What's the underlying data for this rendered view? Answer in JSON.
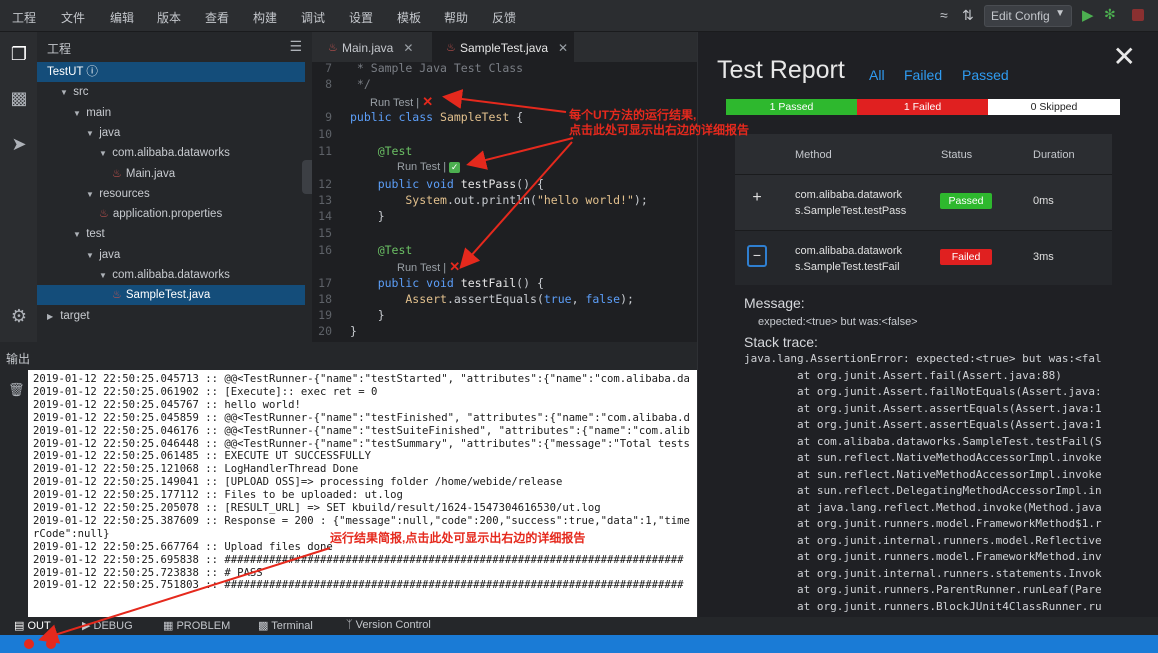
{
  "menubar": {
    "items": [
      "工程",
      "文件",
      "编辑",
      "版本",
      "查看",
      "构建",
      "调试",
      "设置",
      "模板",
      "帮助",
      "反馈"
    ],
    "edit_config": "Edit Config"
  },
  "sidebar": {
    "header": "工程",
    "tree": [
      {
        "label": "TestUT",
        "indent": 0,
        "twisty": "",
        "selected": true,
        "info": true
      },
      {
        "label": "src",
        "indent": 1,
        "twisty": "▼"
      },
      {
        "label": "main",
        "indent": 2,
        "twisty": "▼"
      },
      {
        "label": "java",
        "indent": 3,
        "twisty": "▼"
      },
      {
        "label": "com.alibaba.dataworks",
        "indent": 4,
        "twisty": "▼"
      },
      {
        "label": "Main.java",
        "indent": 5,
        "twisty": "",
        "java": true
      },
      {
        "label": "resources",
        "indent": 3,
        "twisty": "▼"
      },
      {
        "label": "application.properties",
        "indent": 4,
        "twisty": "",
        "java": true
      },
      {
        "label": "test",
        "indent": 2,
        "twisty": "▼"
      },
      {
        "label": "java",
        "indent": 3,
        "twisty": "▼"
      },
      {
        "label": "com.alibaba.dataworks",
        "indent": 4,
        "twisty": "▼"
      },
      {
        "label": "SampleTest.java",
        "indent": 5,
        "twisty": "",
        "java": true,
        "selected": true
      },
      {
        "label": "target",
        "indent": 0,
        "twisty": "▶"
      }
    ]
  },
  "editor": {
    "tabs": [
      {
        "label": "Main.java",
        "active": false
      },
      {
        "label": "SampleTest.java",
        "active": true
      }
    ],
    "run_test_label": "Run Test |"
  },
  "report": {
    "title": "Test Report",
    "filters": [
      "All",
      "Failed",
      "Passed"
    ],
    "summary": {
      "passed": "1 Passed",
      "failed": "1 Failed",
      "skipped": "0 Skipped"
    },
    "columns": {
      "method": "Method",
      "status": "Status",
      "duration": "Duration"
    },
    "rows": [
      {
        "method_line1": "com.alibaba.datawork",
        "method_line2": "s.SampleTest.testPass",
        "status": "Passed",
        "duration": "0ms",
        "expand": "+"
      },
      {
        "method_line1": "com.alibaba.datawork",
        "method_line2": "s.SampleTest.testFail",
        "status": "Failed",
        "duration": "3ms",
        "expand": "−"
      }
    ],
    "message_label": "Message:",
    "message": "expected:<true> but was:<false>",
    "stack_label": "Stack trace:",
    "stack": [
      "java.lang.AssertionError: expected:<true> but was:<fal",
      "        at org.junit.Assert.fail(Assert.java:88)",
      "        at org.junit.Assert.failNotEquals(Assert.java:",
      "        at org.junit.Assert.assertEquals(Assert.java:1",
      "        at org.junit.Assert.assertEquals(Assert.java:1",
      "        at com.alibaba.dataworks.SampleTest.testFail(S",
      "        at sun.reflect.NativeMethodAccessorImpl.invoke",
      "        at sun.reflect.NativeMethodAccessorImpl.invoke",
      "        at sun.reflect.DelegatingMethodAccessorImpl.in",
      "        at java.lang.reflect.Method.invoke(Method.java",
      "        at org.junit.runners.model.FrameworkMethod$1.r",
      "        at org.junit.internal.runners.model.Reflective",
      "        at org.junit.runners.model.FrameworkMethod.inv",
      "        at org.junit.internal.runners.statements.Invok",
      "        at org.junit.runners.ParentRunner.runLeaf(Pare",
      "        at org.junit.runners.BlockJUnit4ClassRunner.ru"
    ]
  },
  "output": {
    "title": "输出",
    "lines": [
      "2019-01-12 22:50:25.045713 :: @@<TestRunner-{\"name\":\"testStarted\", \"attributes\":{\"name\":\"com.alibaba.da",
      "2019-01-12 22:50:25.061902 :: [Execute]:: exec ret = 0",
      "2019-01-12 22:50:25.045767 :: hello world!",
      "2019-01-12 22:50:25.045859 :: @@<TestRunner-{\"name\":\"testFinished\", \"attributes\":{\"name\":\"com.alibaba.d",
      "2019-01-12 22:50:25.046176 :: @@<TestRunner-{\"name\":\"testSuiteFinished\", \"attributes\":{\"name\":\"com.alib",
      "2019-01-12 22:50:25.046448 :: @@<TestRunner-{\"name\":\"testSummary\", \"attributes\":{\"message\":\"Total tests",
      "2019-01-12 22:50:25.061485 :: EXECUTE UT SUCCESSFULLY",
      "2019-01-12 22:50:25.121068 :: LogHandlerThread Done",
      "2019-01-12 22:50:25.149041 :: [UPLOAD OSS]=> processing folder /home/webide/release",
      "2019-01-12 22:50:25.177112 :: Files to be uploaded: ut.log",
      "2019-01-12 22:50:25.205078 :: [RESULT_URL] => SET kbuild/result/1624-1547304616530/ut.log",
      "2019-01-12 22:50:25.387609 :: Response = 200 : {\"message\":null,\"code\":200,\"success\":true,\"data\":1,\"time",
      "rCode\":null}",
      "2019-01-12 22:50:25.667764 :: Upload files done",
      "2019-01-12 22:50:25.695838 :: ########################################################################",
      "2019-01-12 22:50:25.723838 :: # PASS",
      "2019-01-12 22:50:25.751803 :: ########################################################################"
    ]
  },
  "bottom_tabs": [
    "OUT",
    "DEBUG",
    "PROBLEM",
    "Terminal",
    "Version Control"
  ],
  "annotations": {
    "ut_result_line1": "每个UT方法的运行结果,",
    "ut_result_line2": "点击此处可显示出右边的详细报告",
    "summary_hint": "运行结果简报,点击此处可显示出右边的详细报告"
  },
  "colors": {
    "accent": "#1a7bd6",
    "pass": "#2eb82e",
    "fail": "#e02020",
    "annotation": "#e5291d"
  }
}
